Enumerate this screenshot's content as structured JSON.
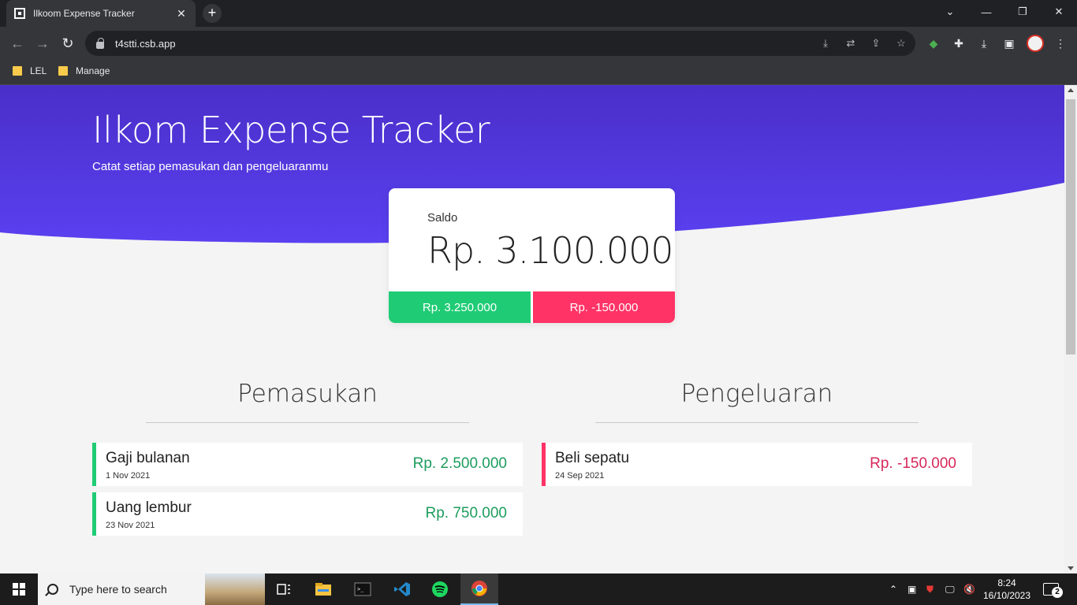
{
  "browser": {
    "tab_title": "Ilkoom Expense Tracker",
    "url": "t4stti.csb.app",
    "bookmarks": [
      "LEL",
      "Manage"
    ]
  },
  "page": {
    "title": "Ilkom Expense Tracker",
    "subtitle": "Catat setiap pemasukan dan pengeluaranmu",
    "balance": {
      "label": "Saldo",
      "amount": "Rp. 3.100.000",
      "income_total": "Rp. 3.250.000",
      "expense_total": "Rp. -150.000"
    },
    "income": {
      "heading": "Pemasukan",
      "items": [
        {
          "name": "Gaji bulanan",
          "date": "1 Nov 2021",
          "amount": "Rp. 2.500.000"
        },
        {
          "name": "Uang lembur",
          "date": "23 Nov 2021",
          "amount": "Rp. 750.000"
        }
      ]
    },
    "expense": {
      "heading": "Pengeluaran",
      "items": [
        {
          "name": "Beli sepatu",
          "date": "24 Sep 2021",
          "amount": "Rp. -150.000"
        }
      ]
    },
    "colors": {
      "hero_top": "#4a2fc9",
      "hero_bottom": "#5a40f0",
      "income": "#1fcc75",
      "expense": "#ff3366"
    }
  },
  "taskbar": {
    "search_placeholder": "Type here to search",
    "time": "8:24",
    "date": "16/10/2023",
    "notification_count": "2"
  }
}
